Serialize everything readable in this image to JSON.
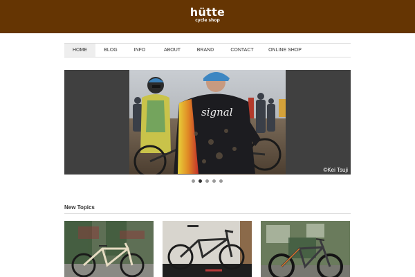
{
  "site": {
    "logo_title": "hütte",
    "logo_subtitle": "cycle shop"
  },
  "nav": {
    "items": [
      {
        "label": "HOME",
        "active": true
      },
      {
        "label": "BLOG",
        "active": false
      },
      {
        "label": "INFO",
        "active": false
      },
      {
        "label": "ABOUT",
        "active": false
      },
      {
        "label": "BRAND",
        "active": false
      },
      {
        "label": "CONTACT",
        "active": false
      },
      {
        "label": "ONLINE SHOP",
        "active": false
      }
    ]
  },
  "slider": {
    "jersey_text": "signal",
    "credit": "©Kei Tsuji",
    "dot_count": 5,
    "active_dot": 2
  },
  "topics": {
    "title": "New Topics"
  },
  "colors": {
    "header_bg": "#653503",
    "slider_bg": "#404040"
  }
}
